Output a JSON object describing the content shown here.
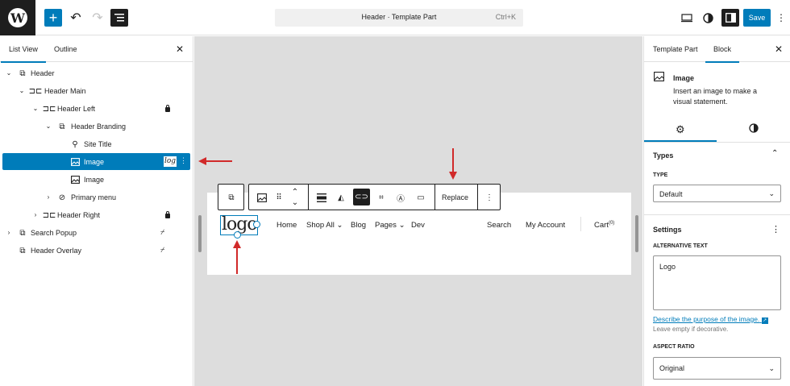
{
  "topbar": {
    "logo_glyph": "W",
    "add_icon": "plus-icon",
    "undo_icon": "undo-icon",
    "redo_icon": "redo-icon",
    "document_overview_icon": "list-view-icon",
    "command_title": "Header · Template Part",
    "command_shortcut": "Ctrl+K",
    "view_icon": "desktop-icon",
    "styles_icon": "half-circle-icon",
    "settings_icon": "sidebar-icon",
    "save_label": "Save",
    "options_icon": "more-vertical-icon"
  },
  "left_panel": {
    "tabs": [
      {
        "label": "List View",
        "active": true
      },
      {
        "label": "Outline",
        "active": false
      }
    ],
    "close_icon": "close-icon",
    "tree": [
      {
        "label": "Header",
        "level": 0,
        "expanded": true,
        "icon": "template-part-icon"
      },
      {
        "label": "Header Main",
        "level": 1,
        "expanded": true,
        "icon": "group-row-icon"
      },
      {
        "label": "Header Left",
        "level": 2,
        "expanded": true,
        "icon": "group-row-icon",
        "locked": true
      },
      {
        "label": "Header Branding",
        "level": 3,
        "expanded": true,
        "icon": "template-part-icon"
      },
      {
        "label": "Site Title",
        "level": 4,
        "icon": "map-marker-icon"
      },
      {
        "label": "Image",
        "level": 4,
        "icon": "image-icon",
        "selected": true,
        "thumb_text": "log"
      },
      {
        "label": "Image",
        "level": 4,
        "icon": "image-icon"
      },
      {
        "label": "Primary menu",
        "level": 3,
        "expanded": false,
        "icon": "navigation-icon"
      },
      {
        "label": "Header Right",
        "level": 2,
        "expanded": false,
        "icon": "group-row-icon",
        "locked": true
      },
      {
        "label": "Search Popup",
        "level": 0,
        "expanded": false,
        "icon": "template-part-icon",
        "hidden": true
      },
      {
        "label": "Header Overlay",
        "level": 0,
        "icon": "template-part-icon",
        "hidden": true
      }
    ]
  },
  "canvas": {
    "logo_text": "logo",
    "nav": [
      "Home",
      "Shop All ⌄",
      "Blog",
      "Pages ⌄",
      "Dev"
    ],
    "search_label": "Search",
    "account_label": "My Account",
    "cart_label": "Cart",
    "cart_count": "(0)",
    "toolbar": {
      "parent_icon": "template-part-icon",
      "block_icon": "image-icon",
      "drag_icon": "drag-handle-icon",
      "move_up_icon": "chevron-up-icon",
      "move_down_icon": "chevron-down-icon",
      "align_icon": "align-icon",
      "duotone_icon": "duotone-icon",
      "link_icon": "link-icon",
      "crop_icon": "crop-icon",
      "text_overlay_icon": "text-overlay-icon",
      "caption_icon": "caption-icon",
      "replace_label": "Replace",
      "more_icon": "more-vertical-icon"
    }
  },
  "right_panel": {
    "tabs": [
      {
        "label": "Template Part",
        "active": false
      },
      {
        "label": "Block",
        "active": true
      }
    ],
    "close_icon": "close-icon",
    "block_card": {
      "icon": "image-icon",
      "title": "Image",
      "description": "Insert an image to make a visual statement."
    },
    "sub_tabs": [
      {
        "icon": "gear-icon",
        "active": true
      },
      {
        "icon": "half-circle-icon",
        "active": false
      }
    ],
    "types_title": "Types",
    "type_label": "TYPE",
    "type_value": "Default",
    "settings_title": "Settings",
    "alt_label": "ALTERNATIVE TEXT",
    "alt_value": "Logo",
    "alt_help_link": "Describe the purpose of the image.",
    "alt_help_text": "Leave empty if decorative.",
    "aspect_label": "ASPECT RATIO",
    "aspect_value": "Original"
  },
  "colors": {
    "accent": "#007cba",
    "annotation_arrow": "#d12a2a",
    "dark": "#1e1e1e",
    "canvas_bg": "#dddddd"
  }
}
